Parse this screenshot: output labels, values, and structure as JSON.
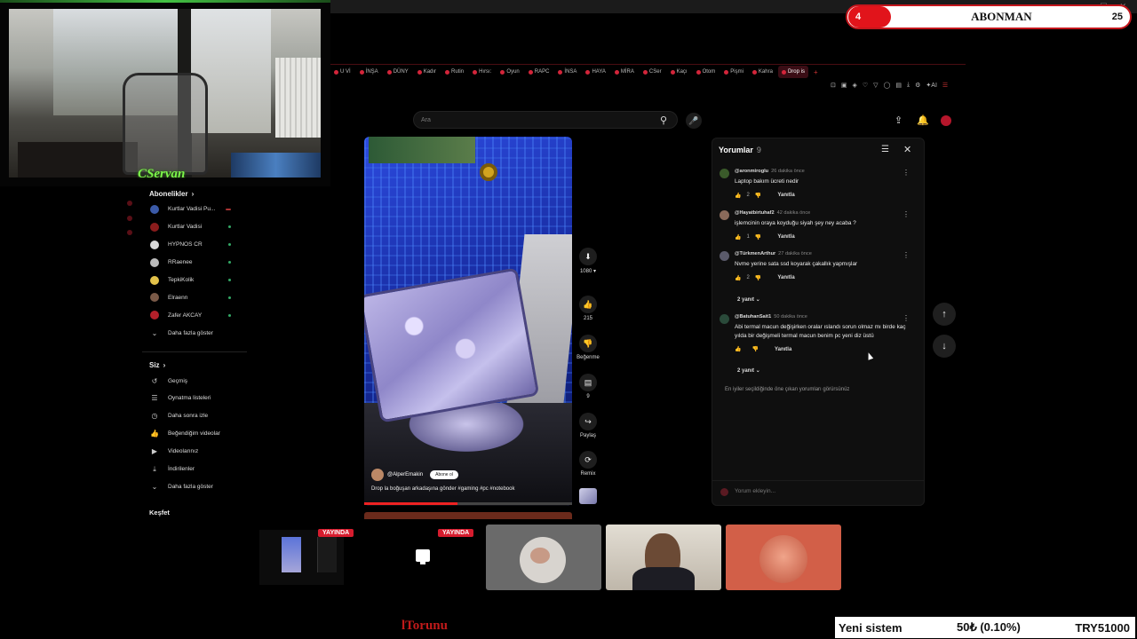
{
  "subscription": {
    "count_left": "4",
    "label": "ABONMAN",
    "count_right": "25"
  },
  "webcam": {
    "streamer_name": "CServan"
  },
  "browser": {
    "tabs": [
      {
        "label": "U Vİ",
        "active": false
      },
      {
        "label": "İNŞA",
        "active": false
      },
      {
        "label": "DÜNY",
        "active": false
      },
      {
        "label": "Kadır",
        "active": false
      },
      {
        "label": "Rutin",
        "active": false
      },
      {
        "label": "Hırsı:",
        "active": false
      },
      {
        "label": "Oyun",
        "active": false
      },
      {
        "label": "RAPC",
        "active": false
      },
      {
        "label": "İNSA",
        "active": false
      },
      {
        "label": "HAYA",
        "active": false
      },
      {
        "label": "MİRA",
        "active": false
      },
      {
        "label": "CSer",
        "active": false
      },
      {
        "label": "Kaçı",
        "active": false
      },
      {
        "label": "Otom",
        "active": false
      },
      {
        "label": "Pişmi",
        "active": false
      },
      {
        "label": "Kahra",
        "active": false
      },
      {
        "label": "Drop is",
        "active": true
      }
    ]
  },
  "youtube": {
    "search_placeholder": "Ara",
    "sidebar": {
      "subscriptions_title": "Abonelikler",
      "subscriptions": [
        {
          "name": "Kurtlar Vadisi Pu...",
          "color": "#3b5aa8",
          "indicator": "red"
        },
        {
          "name": "Kurtlar Vadisi",
          "color": "#8a1c1c",
          "indicator": "dot"
        },
        {
          "name": "HYPNOS CR",
          "color": "#d9d9d9",
          "indicator": "dot"
        },
        {
          "name": "RRaenee",
          "color": "#bbbbbb",
          "indicator": "dot"
        },
        {
          "name": "TepkiKolik",
          "color": "#e3c24a",
          "indicator": "dot"
        },
        {
          "name": "Elraenn",
          "color": "#7a5a48",
          "indicator": "dot"
        },
        {
          "name": "Zafer AKCAY",
          "color": "#b3202a",
          "indicator": "dot"
        }
      ],
      "show_more": "Daha fazla göster",
      "you_title": "Siz",
      "you_items": [
        {
          "label": "Geçmiş",
          "icon": "history-icon",
          "glyph": "↺"
        },
        {
          "label": "Oynatma listeleri",
          "icon": "playlist-icon",
          "glyph": "☰"
        },
        {
          "label": "Daha sonra izle",
          "icon": "clock-icon",
          "glyph": "◷"
        },
        {
          "label": "Beğendiğim videolar",
          "icon": "thumb-up-icon",
          "glyph": "👍"
        },
        {
          "label": "Videolarınız",
          "icon": "video-icon",
          "glyph": "▶"
        },
        {
          "label": "İndirilenler",
          "icon": "download-icon",
          "glyph": "⤓"
        }
      ],
      "show_more_2": "Daha fazla göster",
      "explore_title": "Keşfet"
    },
    "short": {
      "channel": "@AlperEmakin",
      "subscribe_label": "Abone ol",
      "caption": "Drop la boğuşan arkadaşına gönder #gaming #pc #notebook",
      "progress_fraction": 0.45
    },
    "actions": {
      "quality": "1080",
      "likes": "215",
      "dislike_label": "Beğenme",
      "comments_count": "9",
      "share_label": "Paylaş",
      "remix_label": "Remix"
    },
    "comments": {
      "title": "Yorumlar",
      "count": "9",
      "items": [
        {
          "user": "@aronmiroglu",
          "time": "26 dakika önce",
          "text": "Laptop bakım ücreti nedir",
          "likes": "2",
          "reply_label": "Yanıtla",
          "avatar_color": "#3a5a2a"
        },
        {
          "user": "@Hayatbirtuhaf2",
          "time": "42 dakika önce",
          "text": "işlemcinin oraya koyduğu siyah şey ney acaba ?",
          "likes": "1",
          "reply_label": "Yanıtla",
          "avatar_color": "#8a6a5a"
        },
        {
          "user": "@TürkmenArthur",
          "time": "27 dakika önce",
          "text": "Nvme yerine sata ssd koyarak çakallık yapmışlar",
          "likes": "2",
          "reply_label": "Yanıtla",
          "avatar_color": "#5a5a6a"
        },
        {
          "user": "@BatuhanSait1",
          "time": "50 dakika önce",
          "text": "Abi termal macun değişirken oralar ıslandı sorun olmaz mı birde kaç yılda bir değişmeli termal macun benim pc yeni diz üstü",
          "likes": "",
          "reply_label": "Yanıtla",
          "avatar_color": "#2a4a3a"
        }
      ],
      "replies_a": "2 yanıt",
      "replies_b": "2 yanıt",
      "note": "En iyiler seçildiğinde öne çıkan yorumları görürsünüz",
      "add_placeholder": "Yorum ekleyin..."
    }
  },
  "stream": {
    "live_badge_1": "YAYINDA",
    "live_badge_2": "YAYINDA",
    "bottom_text": "lTorunu",
    "ticker": {
      "label": "Yeni sistem",
      "amount": "50₺ (0.10%)",
      "total": "TRY51000"
    }
  }
}
